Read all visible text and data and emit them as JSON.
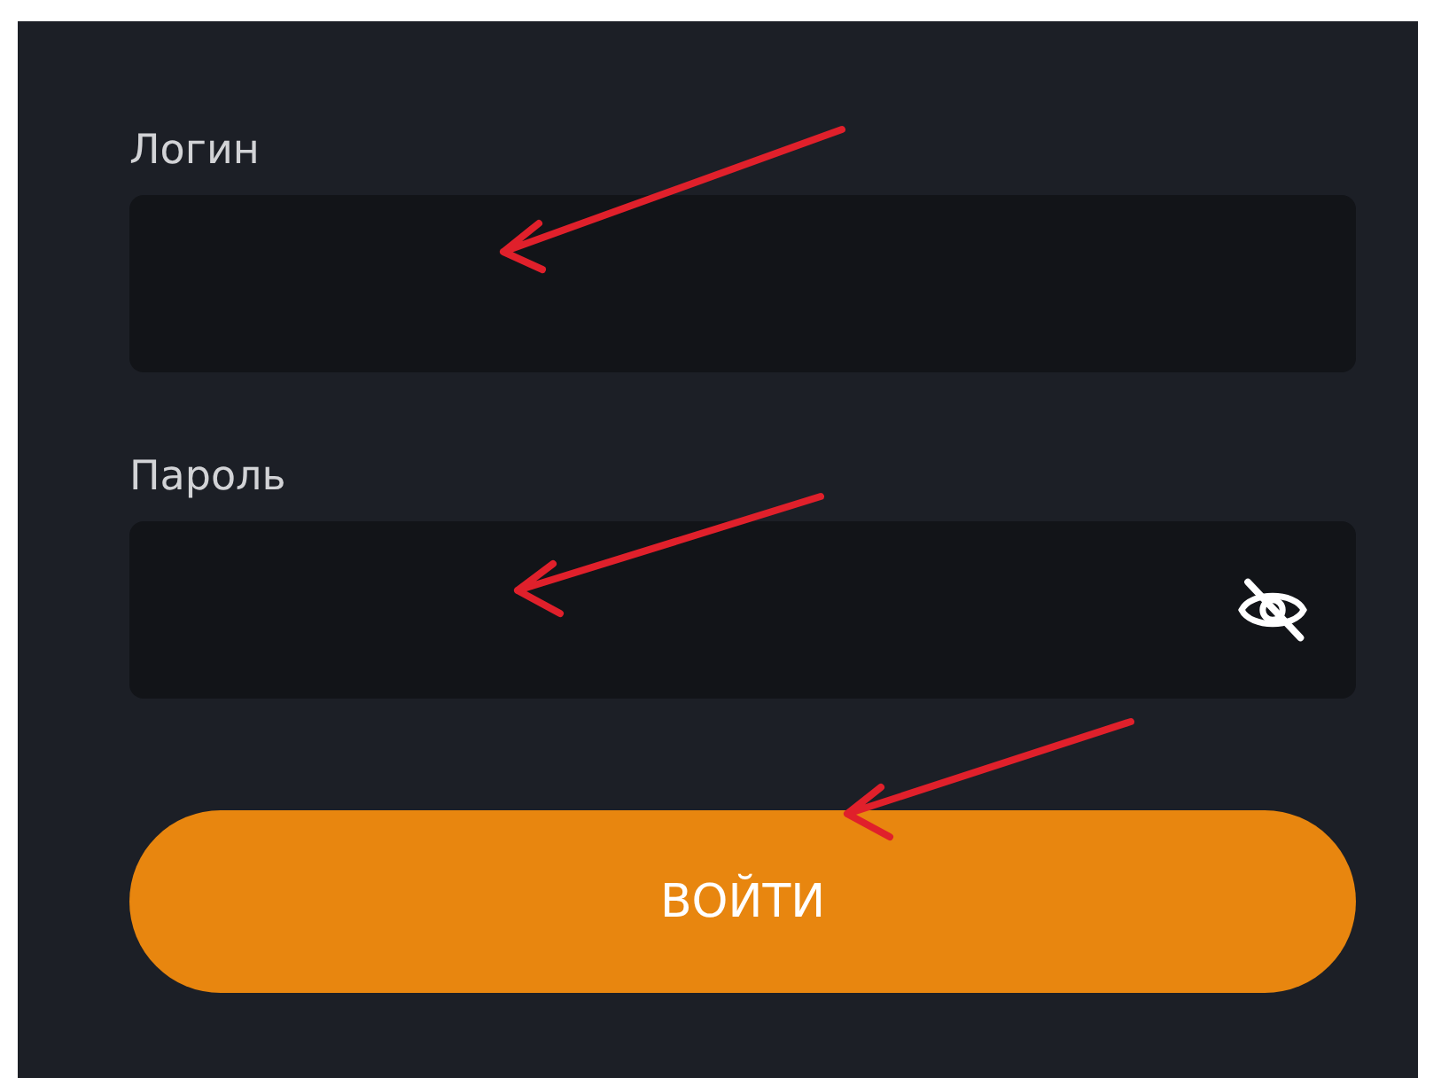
{
  "form": {
    "fields": [
      {
        "label": "Логин",
        "kind": "text"
      },
      {
        "label": "Пароль",
        "kind": "password",
        "password_hidden": true
      }
    ],
    "submit_button": "ВОЙТИ"
  }
}
